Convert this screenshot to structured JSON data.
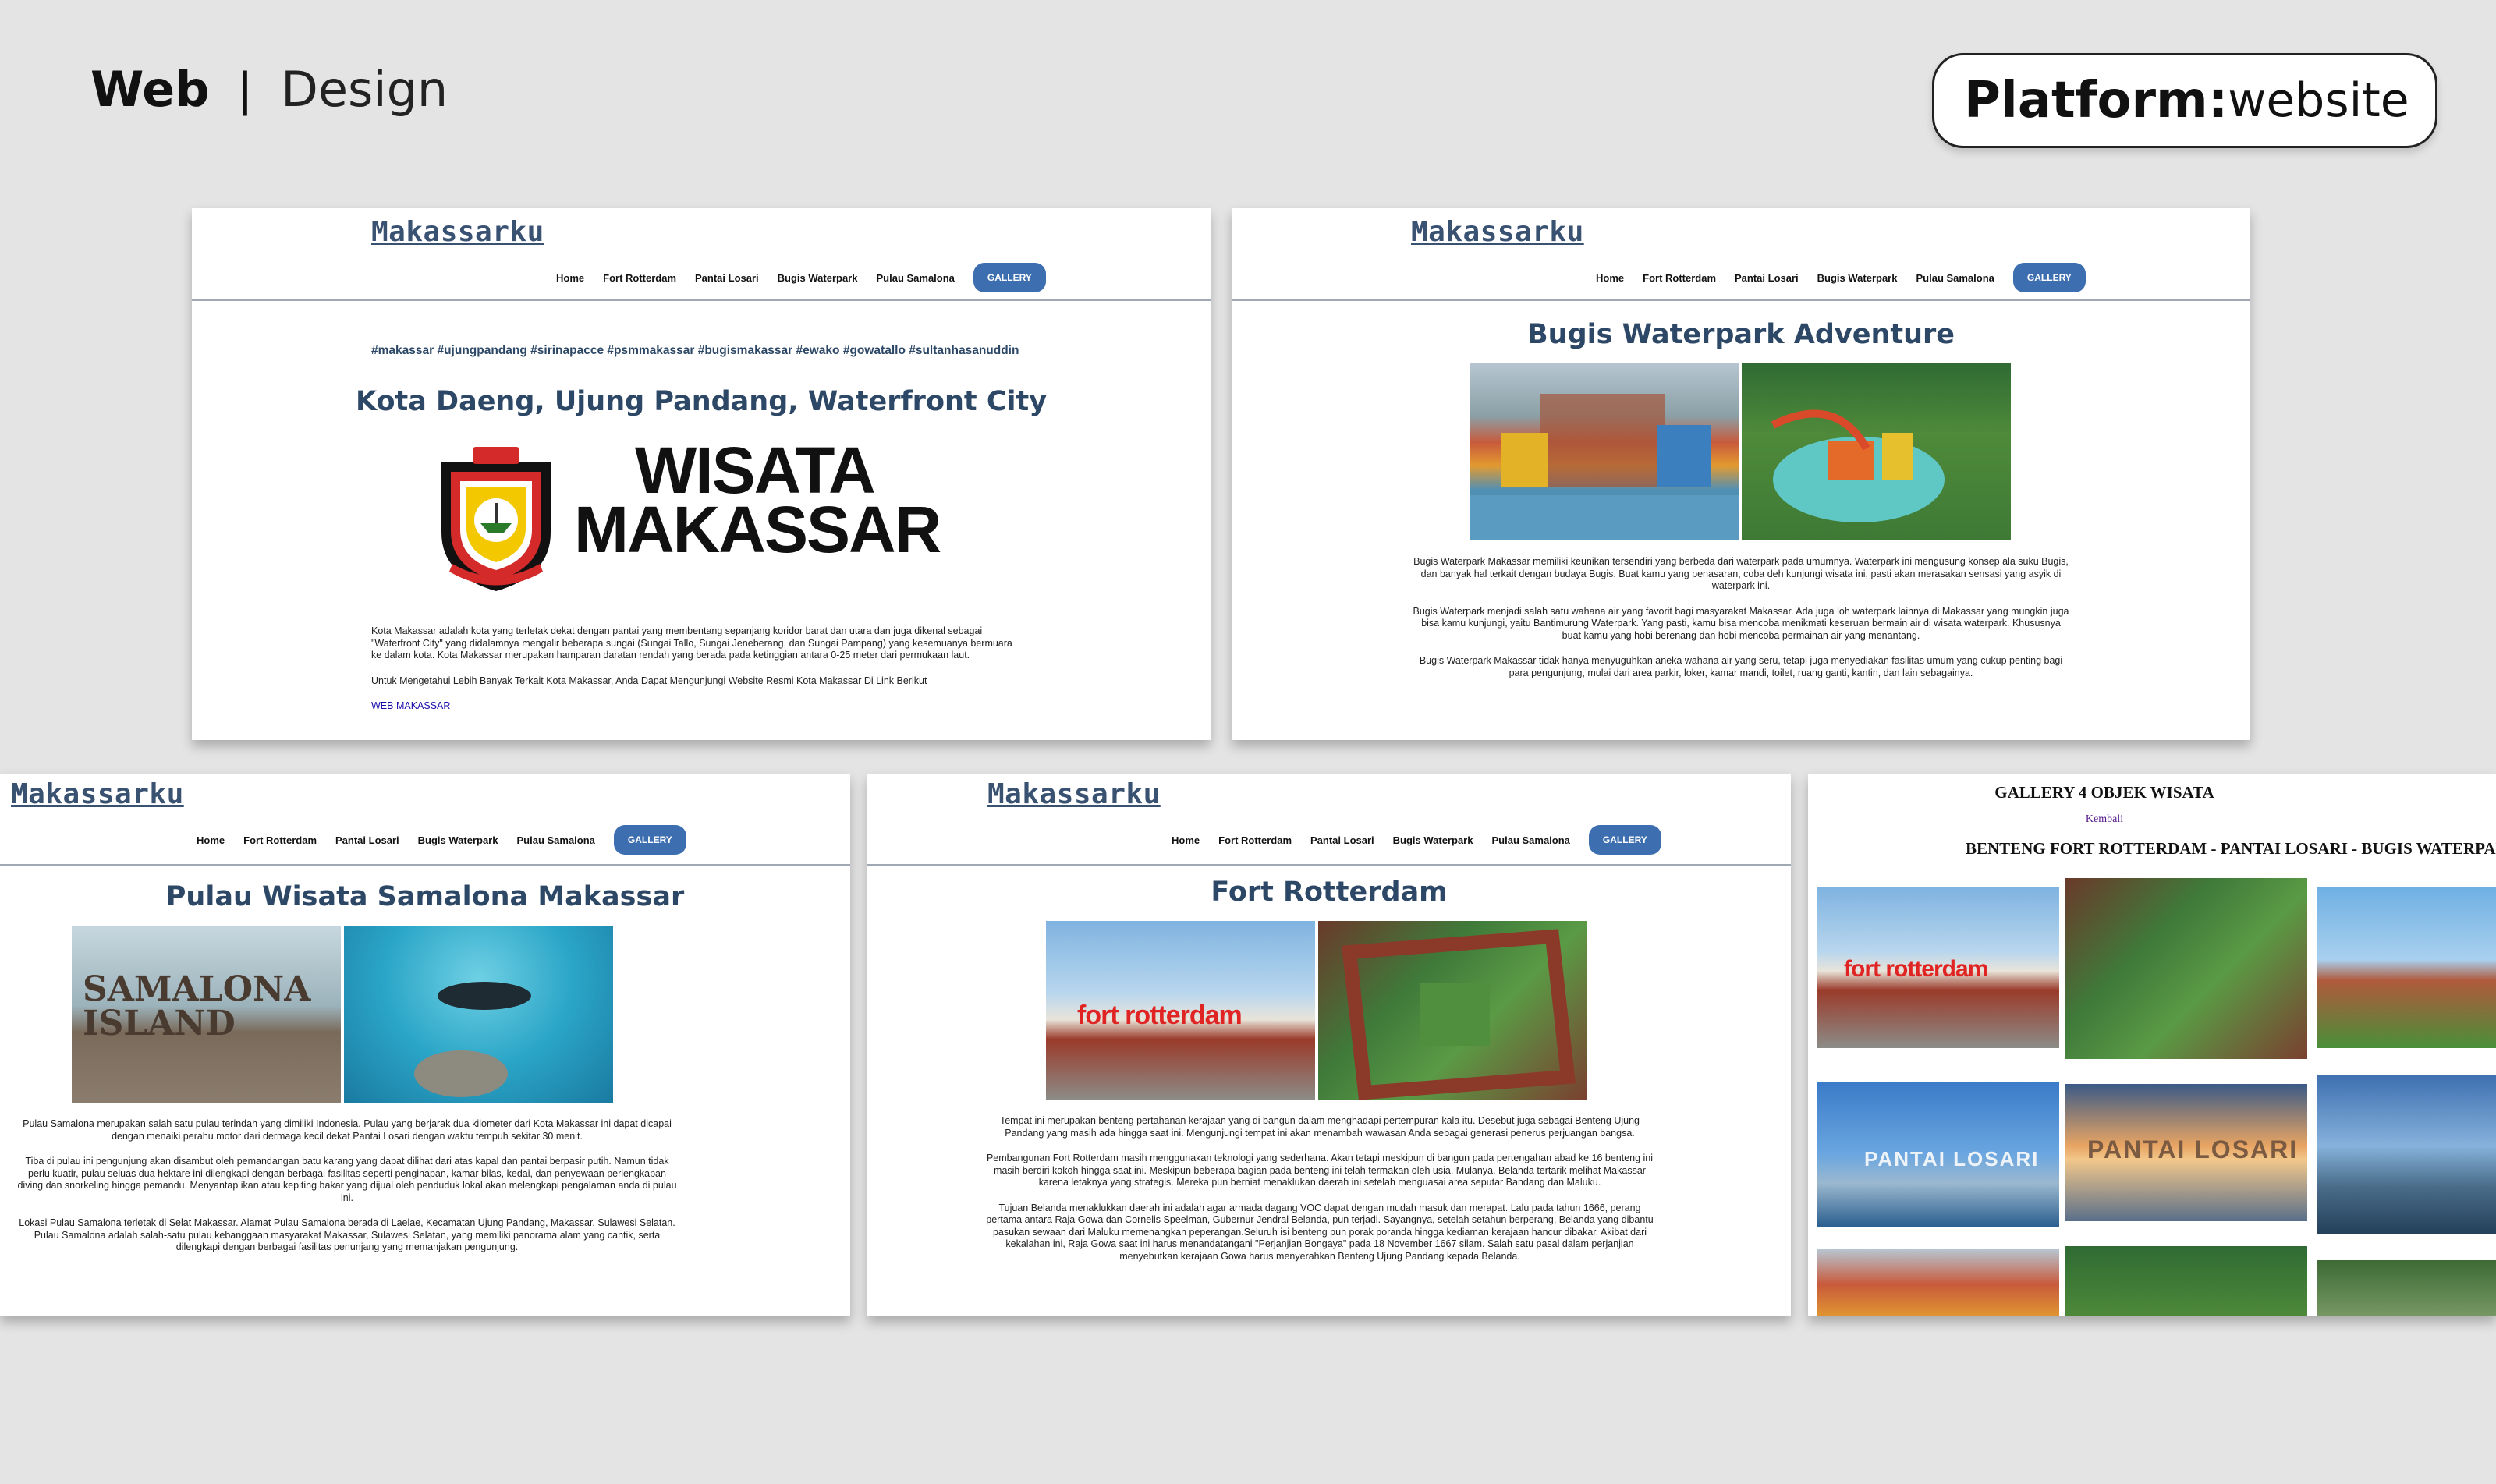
{
  "presentation": {
    "title_bold": "Web",
    "separator": "|",
    "title_light": "Design",
    "platform_label": "Platform:",
    "platform_value": "website"
  },
  "site": {
    "brand": "Makassarku",
    "nav": [
      "Home",
      "Fort Rotterdam",
      "Pantai Losari",
      "Bugis Waterpark",
      "Pulau Samalona"
    ],
    "nav_gallery": "GALLERY"
  },
  "home": {
    "hashtags": "#makassar #ujungpandang #sirinapacce #psmmakassar #bugismakassar #ewako #gowatallo #sultanhasanuddin",
    "heading": "Kota Daeng, Ujung Pandang, Waterfront City",
    "logo_line1": "WISATA",
    "logo_line2": "MAKASSAR",
    "paragraph1": "Kota Makassar adalah kota yang terletak dekat dengan pantai yang membentang sepanjang koridor barat dan utara dan juga dikenal sebagai \"Waterfront City\" yang didalamnya mengalir beberapa sungai (Sungai Tallo, Sungai Jeneberang, dan Sungai Pampang) yang kesemuanya bermuara ke dalam kota. Kota Makassar merupakan hamparan daratan rendah yang berada pada ketinggian antara 0-25 meter dari permukaan laut.",
    "paragraph2": "Untuk Mengetahui Lebih Banyak Terkait Kota Makassar, Anda Dapat Mengunjungi Website Resmi Kota Makassar Di Link Berikut",
    "link": "WEB MAKASSAR"
  },
  "bugis": {
    "heading": "Bugis Waterpark Adventure",
    "p1": "Bugis Waterpark Makassar memiliki keunikan tersendiri yang berbeda dari waterpark pada umumnya. Waterpark ini mengusung konsep ala suku Bugis, dan banyak hal terkait dengan budaya Bugis. Buat kamu yang penasaran, coba deh kunjungi wisata ini, pasti akan merasakan sensasi yang asyik di waterpark ini.",
    "p2": "Bugis Waterpark menjadi salah satu wahana air yang favorit bagi masyarakat Makassar. Ada juga loh waterpark lainnya di Makassar yang mungkin juga bisa kamu kunjungi, yaitu Bantimurung Waterpark. Yang pasti, kamu bisa mencoba menikmati keseruan bermain air di wisata waterpark. Khususnya buat kamu yang hobi berenang dan hobi mencoba permainan air yang menantang.",
    "p3": "Bugis Waterpark Makassar tidak hanya menyuguhkan aneka wahana air yang seru, tetapi juga menyediakan fasilitas umum yang cukup penting bagi para pengunjung, mulai dari area parkir, loker, kamar mandi, toilet, ruang ganti, kantin, dan lain sebagainya."
  },
  "samalona": {
    "heading": "Pulau Wisata Samalona Makassar",
    "photo_caption": "SAMALONA ISLAND",
    "p1": "Pulau Samalona merupakan salah satu pulau terindah yang dimiliki Indonesia. Pulau yang berjarak dua kilometer dari Kota Makassar ini dapat dicapai dengan menaiki perahu motor dari dermaga kecil dekat Pantai Losari dengan waktu tempuh sekitar 30 menit.",
    "p2": "Tiba di pulau ini pengunjung akan disambut oleh pemandangan batu karang yang dapat dilihat dari atas kapal dan pantai berpasir putih. Namun tidak perlu kuatir, pulau seluas dua hektare ini dilengkapi dengan berbagai fasilitas seperti penginapan, kamar bilas, kedai, dan penyewaan perlengkapan diving dan snorkeling hingga pemandu. Menyantap ikan atau kepiting bakar yang dijual oleh penduduk lokal akan melengkapi pengalaman anda di pulau ini.",
    "p3": "Lokasi Pulau Samalona terletak di Selat Makassar. Alamat Pulau Samalona berada di Laelae, Kecamatan Ujung Pandang, Makassar, Sulawesi Selatan. Pulau Samalona adalah salah-satu pulau kebanggaan masyarakat Makassar, Sulawesi Selatan, yang memiliki panorama alam yang cantik, serta dilengkapi dengan berbagai fasilitas penunjang yang memanjakan pengunjung."
  },
  "fort": {
    "heading": "Fort Rotterdam",
    "photo_caption": "fort rotterdam",
    "p1": "Tempat ini merupakan benteng pertahanan kerajaan yang di bangun dalam menghadapi pertempuran kala itu. Desebut juga sebagai Benteng Ujung Pandang yang masih ada hingga saat ini. Mengunjungi tempat ini akan menambah wawasan Anda sebagai generasi penerus perjuangan bangsa.",
    "p2": "Pembangunan Fort Rotterdam masih menggunakan teknologi yang sederhana. Akan tetapi meskipun di bangun pada pertengahan abad ke 16 benteng ini masih berdiri kokoh hingga saat ini. Meskipun beberapa bagian pada benteng ini telah termakan oleh usia. Mulanya, Belanda tertarik melihat Makassar karena letaknya yang strategis. Mereka pun berniat menaklukan daerah ini setelah menguasai area seputar Bandang dan Maluku.",
    "p3": "Tujuan Belanda menaklukkan daerah ini adalah agar armada dagang VOC dapat dengan mudah masuk dan merapat. Lalu pada tahun 1666, perang pertama antara Raja Gowa dan Cornelis Speelman, Gubernur Jendral Belanda, pun terjadi. Sayangnya, setelah setahun berperang, Belanda yang dibantu pasukan sewaan dari Maluku memenangkan peperangan.Seluruh isi benteng pun porak poranda hingga kediaman kerajaan hancur dibakar. Akibat dari kekalahan ini, Raja Gowa saat ini harus menandatangani \"Perjanjian Bongaya\" pada 18 November 1667 silam. Salah satu pasal dalam perjanjian menyebutkan kerajaan Gowa harus menyerahkan Benteng Ujung Pandang kepada Belanda."
  },
  "gallery": {
    "title": "GALLERY 4 OBJEK WISATA",
    "back_link": "Kembali",
    "subtitle": "BENTENG FORT ROTTERDAM - PANTAI LOSARI - BUGIS WATERPARK",
    "losari_caption": "PANTAI LOSARI"
  }
}
